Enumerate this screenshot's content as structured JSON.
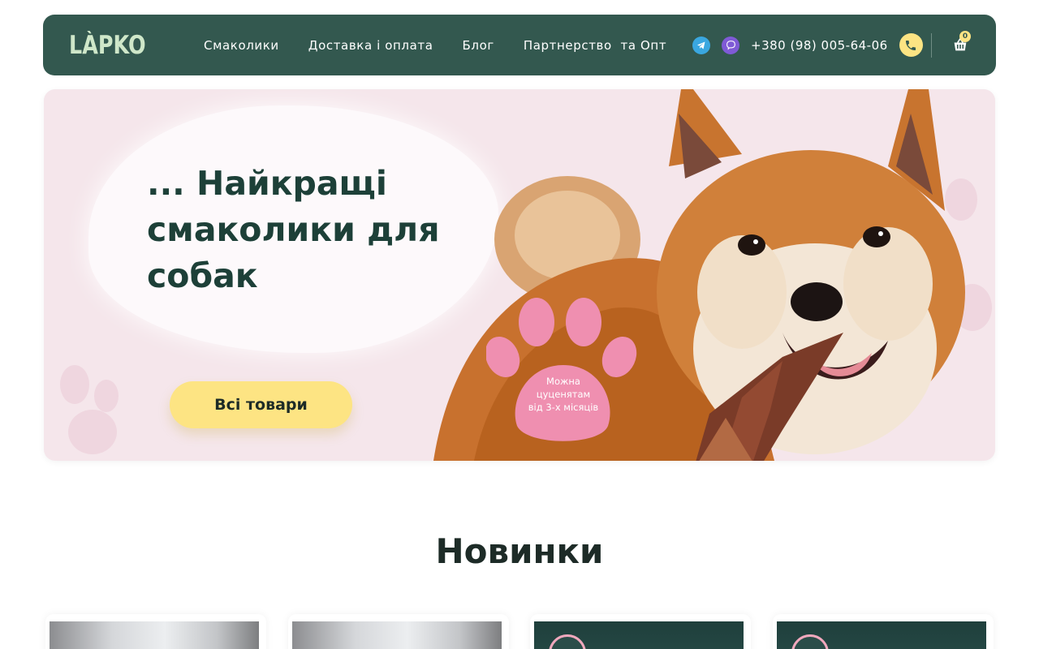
{
  "header": {
    "logo": "LÀPKO",
    "nav": [
      "Смаколики",
      "Доставка і оплата",
      "Блог",
      "Партнерство  та Опт"
    ],
    "phone": "+380 (98) 005-64-06",
    "cart_count": "0",
    "icons": [
      "telegram-icon",
      "viber-icon",
      "phone-icon",
      "cart-icon"
    ]
  },
  "hero": {
    "title": "... Найкращі\nсмаколики для\n  собак",
    "cta": "Всі товари",
    "badge_text": "Можна\nцуценятам\nвід 3-х місяців"
  },
  "new_arrivals": {
    "title": "Новинки"
  },
  "colors": {
    "header_bg": "#33584f",
    "accent_yellow": "#fde483",
    "hero_bg": "#f5e6eb",
    "paw_pink": "#ef8fb0",
    "title_green": "#1d4038"
  }
}
